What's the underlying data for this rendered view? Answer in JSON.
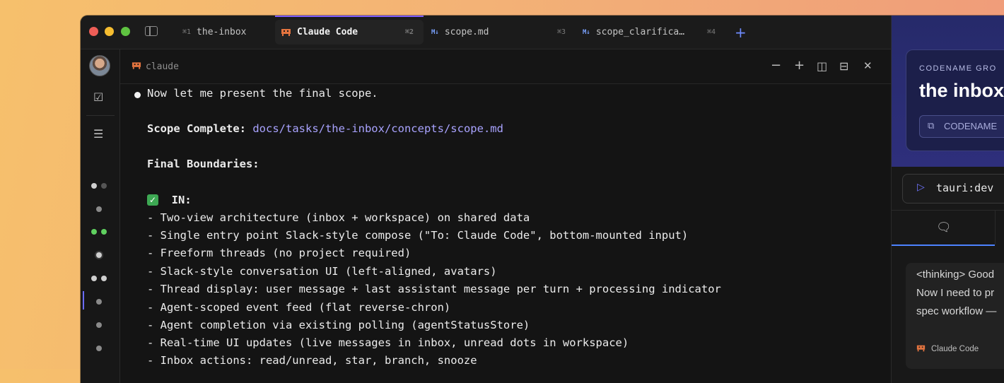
{
  "tabs": [
    {
      "kbd": "⌘1",
      "label": "the-inbox"
    },
    {
      "label": "Claude Code",
      "kbd": "⌘2"
    },
    {
      "label": "scope.md",
      "kbd": "⌘3"
    },
    {
      "label": "scope_clarifica…",
      "kbd": "⌘4"
    }
  ],
  "md_badge": "M↓",
  "pane": {
    "title": "claude",
    "controls": {
      "minimize": "−",
      "add": "+",
      "split": "◫",
      "layout": "⊟",
      "close": "✕"
    }
  },
  "terminal": {
    "intro": "Now let me present the final scope.",
    "scope_label": "Scope Complete:",
    "scope_path": "docs/tasks/the-inbox/concepts/scope.md",
    "boundaries_label": "Final Boundaries:",
    "in_label": "IN:",
    "items": [
      "- Two-view architecture (inbox + workspace) on shared data",
      "- Single entry point Slack-style compose (\"To: Claude Code\", bottom-mounted input)",
      "- Freeform threads (no project required)",
      "- Slack-style conversation UI (left-aligned, avatars)",
      "- Thread display: user message + last assistant message per turn + processing indicator",
      "- Agent-scoped event feed (flat reverse-chron)",
      "- Agent completion via existing polling (agentStatusStore)",
      "- Real-time UI updates (live messages in inbox, unread dots in workspace)",
      "- Inbox actions: read/unread, star, branch, snooze"
    ]
  },
  "right_panel": {
    "kicker": "CODENAME GRO",
    "title": "the inbox",
    "chip_label": "CODENAME",
    "run_label": "tauri:dev",
    "message_lines": [
      "<thinking> Good",
      "Now I need to pr",
      "spec workflow —"
    ],
    "message_author": "Claude Code"
  },
  "colors": {
    "accent": "#7d5cff",
    "link": "#a9a3ff",
    "status_green": "#5fd05f",
    "hero_bg": "#2e2f7c"
  },
  "icons": [
    "sidebar-toggle-icon",
    "check-square-icon",
    "checklist-icon",
    "play-icon",
    "chat-icon",
    "claude-icon",
    "layers-icon"
  ]
}
